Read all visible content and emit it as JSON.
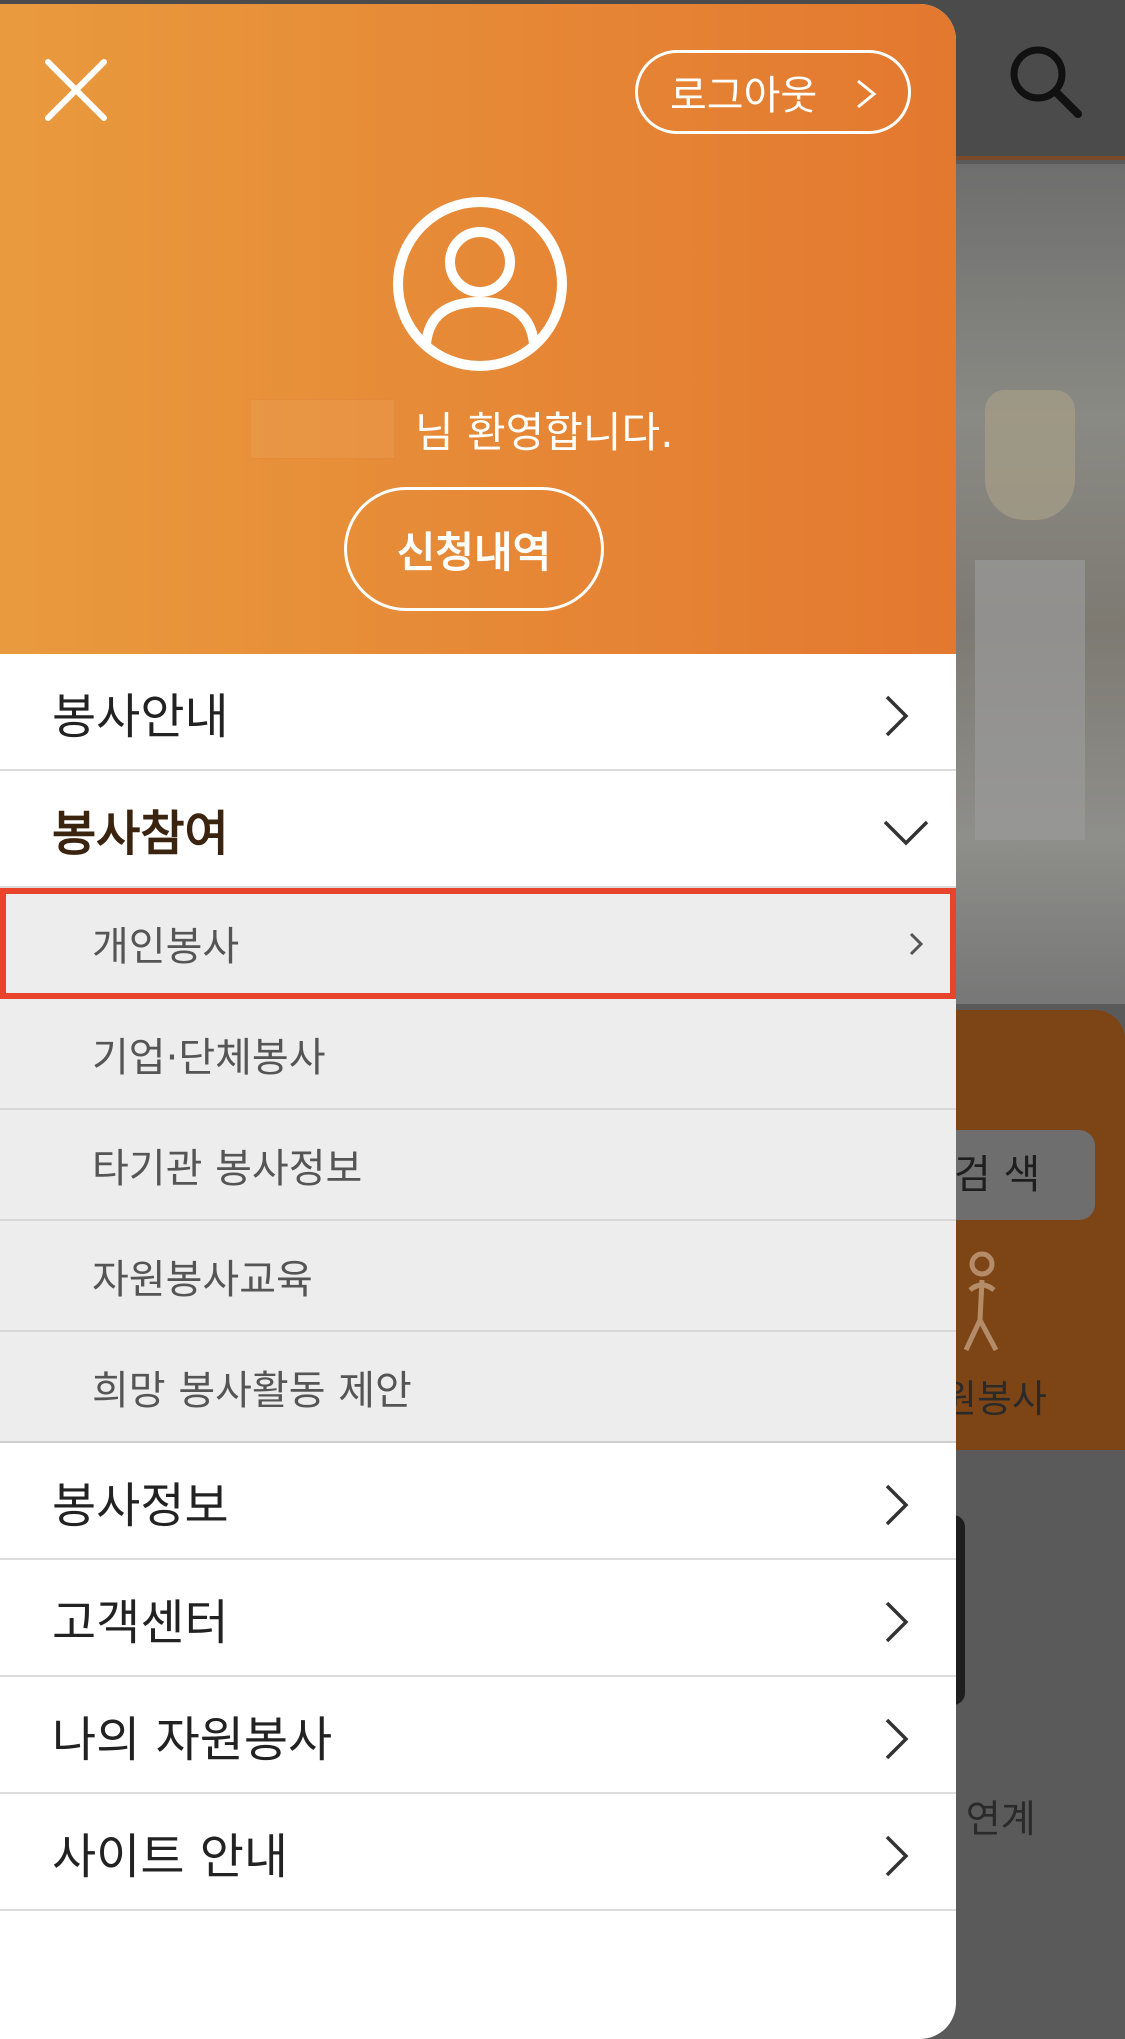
{
  "header": {
    "logout_label": "로그아웃",
    "welcome_suffix": "님 환영합니다.",
    "history_label": "신청내역"
  },
  "menu": {
    "items_top": [
      {
        "label": "봉사안내"
      },
      {
        "label": "봉사참여"
      }
    ],
    "submenu": [
      {
        "label": "개인봉사"
      },
      {
        "label": "기업·단체봉사"
      },
      {
        "label": "타기관 봉사정보"
      },
      {
        "label": "자원봉사교육"
      },
      {
        "label": "희망 봉사활동 제안"
      }
    ],
    "items_bottom": [
      {
        "label": "봉사정보"
      },
      {
        "label": "고객센터"
      },
      {
        "label": "나의 자원봉사"
      },
      {
        "label": "사이트 안내"
      }
    ]
  },
  "background": {
    "search_button": "검 색",
    "volunteer_label": "원봉사",
    "link_label": "- 연계"
  },
  "colors": {
    "header_start": "#e99a3e",
    "header_end": "#e3782f",
    "highlight_border": "#e8432b"
  }
}
